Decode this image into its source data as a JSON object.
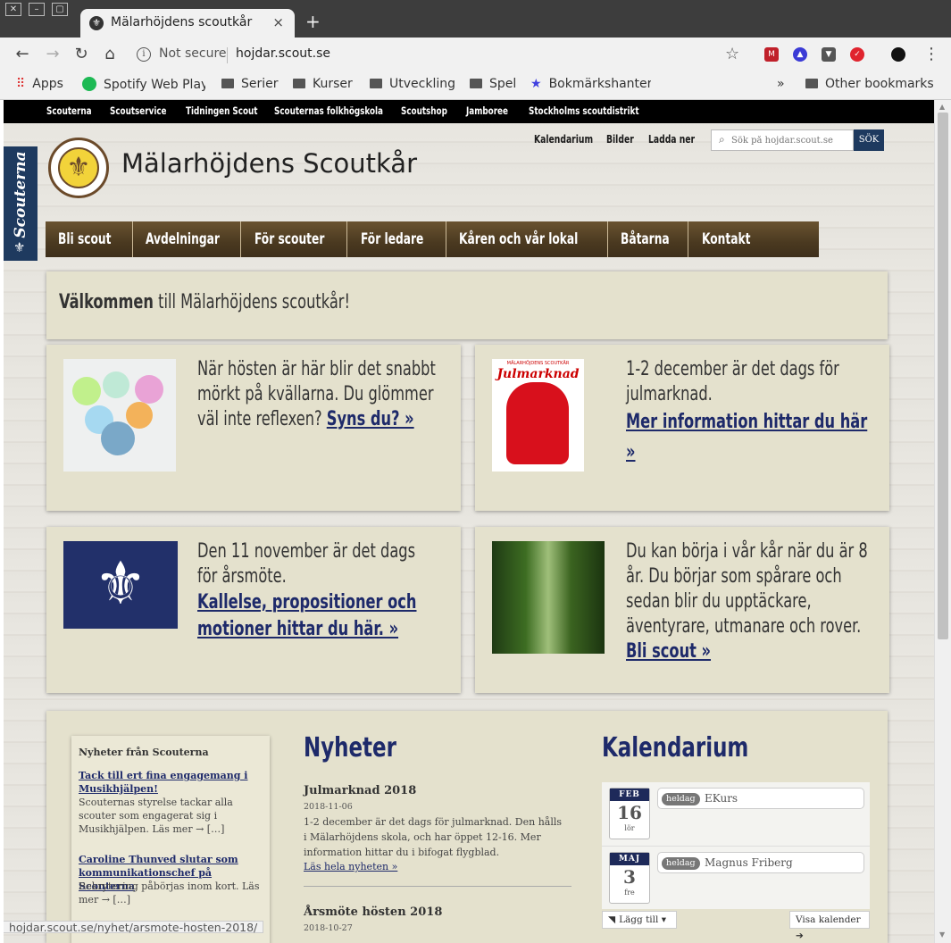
{
  "browser": {
    "tab_title": "Mälarhöjdens scoutkår",
    "tab_close": "×",
    "new_tab": "+",
    "not_secure": "Not secure",
    "url": "hojdar.scout.se",
    "bookmarks": [
      "Apps",
      "Spotify Web Play",
      "Serier",
      "Kurser",
      "Utveckling",
      "Spel",
      "Bokmärkshanter"
    ],
    "bookmarks_overflow": "»",
    "other_bookmarks": "Other bookmarks",
    "status_url": "hojdar.scout.se/nyhet/arsmote-hosten-2018/"
  },
  "site": {
    "topbar": [
      "Scouterna",
      "Scoutservice",
      "Tidningen Scout",
      "Scouternas folkhögskola",
      "Scoutshop",
      "Jamboree",
      "Stockholms scoutdistrikt"
    ],
    "side_badge": "Scouterna",
    "name": "Mälarhöjdens Scoutkår",
    "top_links": [
      "Kalendarium",
      "Bilder",
      "Ladda ner"
    ],
    "search_placeholder": "Sök på hojdar.scout.se",
    "search_button": "SÖK",
    "nav": [
      "Bli scout",
      "Avdelningar",
      "För scouter",
      "För ledare",
      "Kåren och vår lokal",
      "Båtarna",
      "Kontakt"
    ]
  },
  "welcome": {
    "bold": "Välkommen",
    "rest": " till Mälarhöjdens scoutkår!"
  },
  "cards": [
    {
      "text": "När hösten är här blir det snabbt mörkt på kvällarna. Du glömmer väl inte reflexen? ",
      "link": "Syns du? »"
    },
    {
      "text": "1-2 december är det dags för julmarknad.",
      "link": "Mer information hittar du här »",
      "poster_title": "Julmarknad",
      "poster_org": "MÄLARHÖJDENS SCOUTKÅR"
    },
    {
      "text": "Den 11 november är det dags för årsmöte.",
      "link": "Kallelse, propositioner och motioner hittar du här. »"
    },
    {
      "text": "Du kan börja i vår kår när du är 8 år. Du börjar som spårare och sedan blir du upptäckare, äventyrare, utmanare och rover. ",
      "link": "Bli scout »"
    }
  ],
  "scouterna_news": {
    "heading": "Nyheter från Scouterna",
    "items": [
      {
        "title": "Tack till ert fina engagemang i Musikhjälpen!",
        "text": "Scouternas styrelse tackar alla scouter som engagerat sig i Musikhjälpen. Läs mer → […]"
      },
      {
        "title": "Caroline Thunved slutar som kommunikationschef på Scouterna",
        "text": "Rekrytering påbörjas inom kort. Läs mer → […]"
      }
    ]
  },
  "news": {
    "heading": "Nyheter",
    "items": [
      {
        "title": "Julmarknad 2018",
        "date": "2018-11-06",
        "body": "1-2 december är det dags för julmarknad. Den hålls i Mälarhöjdens skola, och har öppet 12-16.   Mer information hittar du i bifogat flygblad.",
        "read_more": "Läs hela nyheten »"
      },
      {
        "title": "Årsmöte hösten 2018",
        "date": "2018-10-27"
      }
    ]
  },
  "calendar": {
    "heading": "Kalendarium",
    "events": [
      {
        "month": "FEB",
        "day": "16",
        "weekday": "lör",
        "tag": "heldag",
        "name": "EKurs"
      },
      {
        "month": "MAJ",
        "day": "3",
        "weekday": "fre",
        "tag": "heldag",
        "name": "Magnus Friberg"
      }
    ],
    "add_button": "Lägg till",
    "show_button": "Visa kalender"
  }
}
